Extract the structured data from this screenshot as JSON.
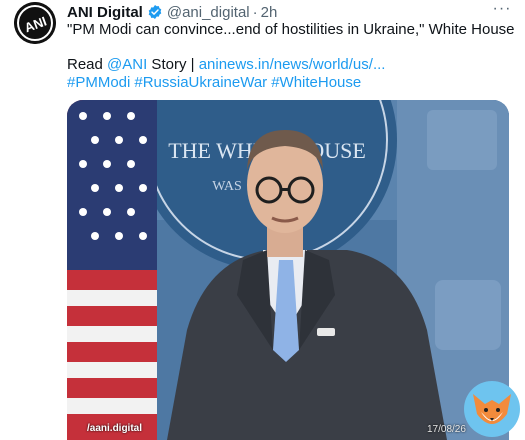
{
  "author": {
    "display_name": "ANI Digital",
    "handle": "@ani_digital",
    "separator": "·",
    "time": "2h",
    "verified": true,
    "avatar_text": "ANI"
  },
  "menu": {
    "more_label": "···"
  },
  "tweet": {
    "quote": "\"PM Modi can convince...end of hostilities in Ukraine,\" White House",
    "read_prefix": "Read ",
    "mention": "@ANI",
    "story_text": " Story | ",
    "link_text": "aninews.in/news/world/us/...",
    "hashtags": [
      "#PMModi",
      "#RussiaUkraineWar",
      "#WhiteHouse"
    ]
  },
  "media": {
    "podium_text": "THE WHITE HOUSE",
    "podium_subtext": "WAS",
    "watermark_handle": "/aani.digital",
    "watermark_date": "17/08/26"
  },
  "colors": {
    "link": "#1d9bf0",
    "secondary_text": "#536471",
    "verified_badge": "#1d9bf0",
    "backdrop_blue": "#4f79a4"
  }
}
